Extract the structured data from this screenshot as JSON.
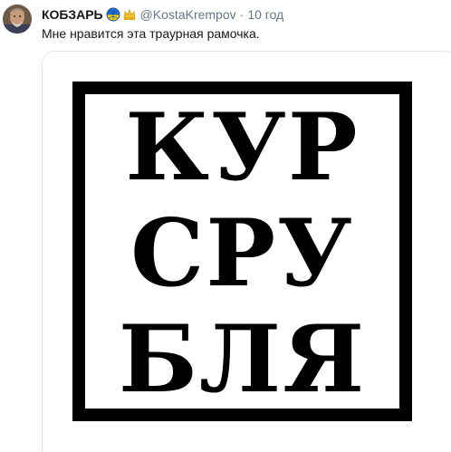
{
  "tweet": {
    "author_name": "КОБЗАРЬ",
    "handle": "@KostaKrempov",
    "separator": "·",
    "time": "10 год",
    "text": "Мне нравится эта траурная рамочка.",
    "icons": [
      "globe-flag-icon",
      "crown-icon"
    ]
  },
  "image": {
    "lines": [
      "КУР",
      "СРУ",
      "БЛЯ"
    ],
    "frame_color": "#000000",
    "background_color": "#ffffff"
  },
  "colors": {
    "name": "#14171a",
    "secondary": "#657786",
    "media_border": "#e1e8ed"
  }
}
